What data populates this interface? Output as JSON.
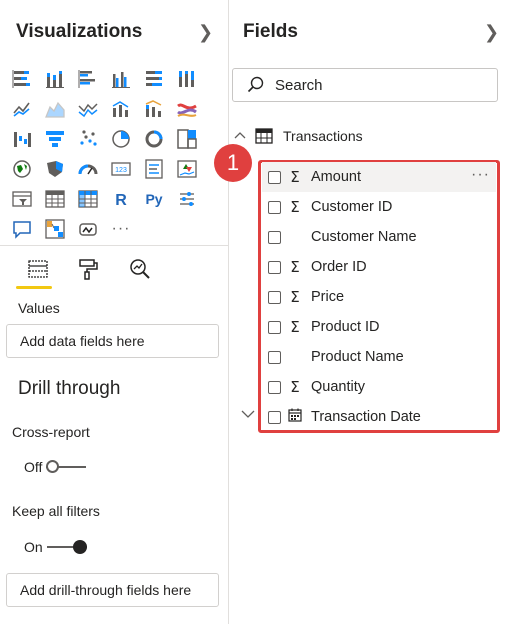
{
  "visualizations": {
    "title": "Visualizations",
    "more_label": "···",
    "tiles": [
      "stacked-bar-icon",
      "stacked-column-icon",
      "clustered-bar-icon",
      "clustered-column-icon",
      "100-stacked-bar-icon",
      "100-stacked-column-icon",
      "line-chart-icon",
      "area-chart-icon",
      "stacked-area-icon",
      "line-clustered-column-icon",
      "line-stacked-column-icon",
      "ribbon-chart-icon",
      "waterfall-icon",
      "funnel-icon",
      "scatter-icon",
      "pie-chart-icon",
      "donut-chart-icon",
      "treemap-icon",
      "map-icon",
      "filled-map-icon",
      "gauge-icon",
      "card-icon",
      "multi-row-card-icon",
      "kpi-icon",
      "slicer-icon",
      "table-icon",
      "matrix-icon",
      "r-visual-icon",
      "python-visual-icon",
      "key-influencers-icon",
      "qa-icon",
      "decomposition-tree-icon",
      "paginated-report-icon",
      "more-visuals-icon"
    ],
    "r_label": "R",
    "py_label": "Py",
    "card_label": "123"
  },
  "tabs": [
    "fields-tab",
    "format-tab",
    "analytics-tab"
  ],
  "values": {
    "label": "Values",
    "placeholder": "Add data fields here"
  },
  "drill": {
    "title": "Drill through",
    "cross_report_label": "Cross-report",
    "cross_report_state": "Off",
    "keep_filters_label": "Keep all filters",
    "keep_filters_state": "On",
    "placeholder": "Add drill-through fields here"
  },
  "fields": {
    "title": "Fields",
    "search_placeholder": "Search",
    "table_name": "Transactions",
    "badge": "1",
    "more_label": "···",
    "items": [
      {
        "name": "Amount",
        "sigma": "Σ"
      },
      {
        "name": "Customer ID",
        "sigma": "Σ"
      },
      {
        "name": "Customer Name",
        "sigma": ""
      },
      {
        "name": "Order ID",
        "sigma": "Σ"
      },
      {
        "name": "Price",
        "sigma": "Σ"
      },
      {
        "name": "Product ID",
        "sigma": "Σ"
      },
      {
        "name": "Product Name",
        "sigma": ""
      },
      {
        "name": "Quantity",
        "sigma": "Σ"
      },
      {
        "name": "Transaction Date",
        "sigma": "calendar"
      }
    ]
  },
  "colors": {
    "accent_yellow": "#f2c811",
    "highlight_red": "#e0403f",
    "text": "#252423"
  }
}
